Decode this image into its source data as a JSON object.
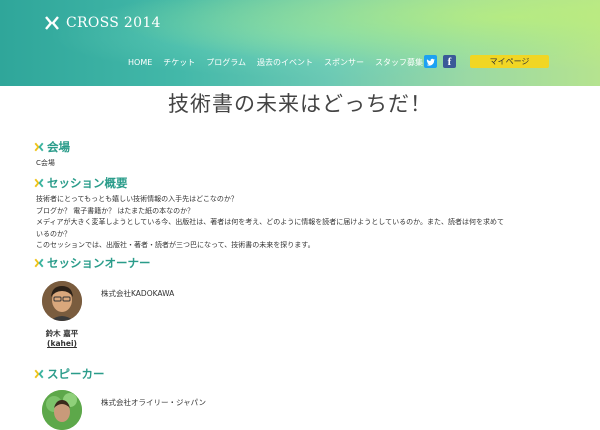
{
  "logo": {
    "text": "CROSS 2014",
    "icon": "cross-logo-icon"
  },
  "nav": {
    "items": [
      "HOME",
      "チケット",
      "プログラム",
      "過去のイベント",
      "スポンサー",
      "スタッフ募集"
    ],
    "twitter_icon": "twitter-icon",
    "facebook_icon": "facebook-icon",
    "facebook_glyph": "f",
    "mypage_label": "マイページ"
  },
  "page_title": "技術書の未来はどっちだ！",
  "venue": {
    "heading": "会場",
    "value": "C会場"
  },
  "session": {
    "heading": "セッション概要",
    "lines": [
      "技術者にとってもっとも嬉しい技術情報の入手先はどこなのか？",
      "ブログか？ 電子書籍か？ はたまた紙の本なのか？",
      "メディアが大きく変革しようとしている今、出版社は、著者は何を考え、どのように情報を読者に届けようとしているのか。また、読者は何を求めて",
      "いるのか？",
      "このセッションでは、出版社・著者・読者が三つ巴になって、技術書の未来を探ります。"
    ]
  },
  "owner": {
    "heading": "セッションオーナー",
    "name": "鈴木 嘉平",
    "handle": "(kahei)",
    "company": "株式会社KADOKAWA"
  },
  "speaker": {
    "heading": "スピーカー",
    "company": "株式会社オライリー・ジャパン"
  },
  "colors": {
    "accent": "#2a9c8a",
    "mypage": "#f1d624"
  }
}
